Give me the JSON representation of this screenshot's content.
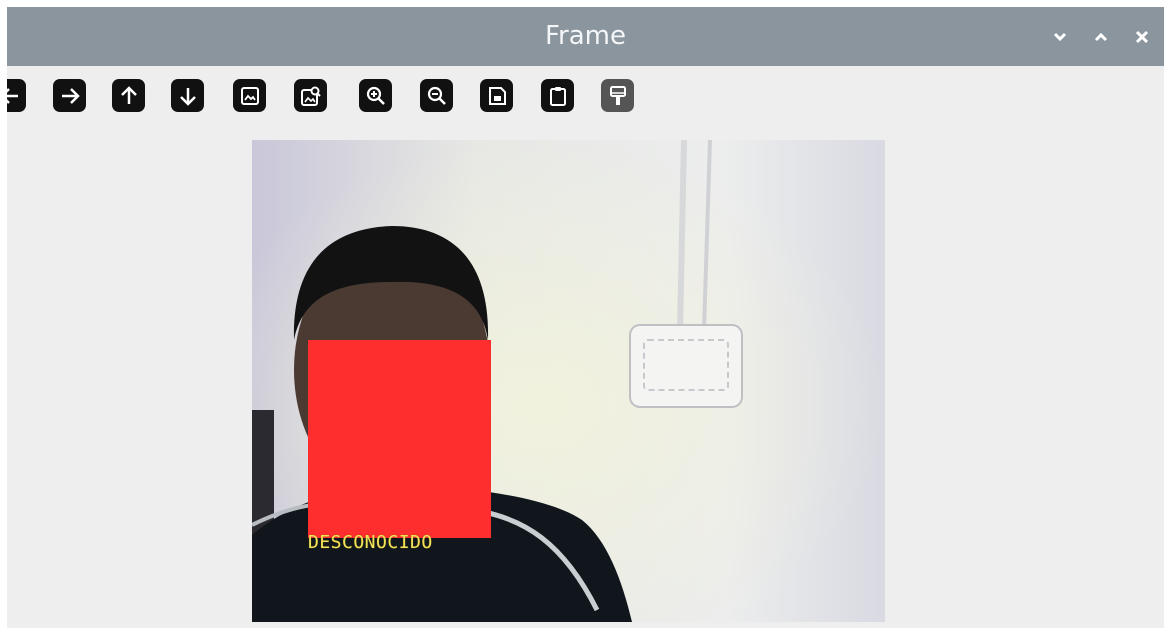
{
  "window": {
    "title": "Frame",
    "controls": [
      {
        "name": "minimize",
        "icon": "chevron-down-icon"
      },
      {
        "name": "maximize",
        "icon": "chevron-up-icon"
      },
      {
        "name": "close",
        "icon": "close-icon"
      }
    ]
  },
  "toolbar": {
    "buttons": [
      {
        "name": "pan-left",
        "icon": "arrow-left-icon"
      },
      {
        "name": "pan-right",
        "icon": "arrow-right-icon"
      },
      {
        "name": "pan-up",
        "icon": "arrow-up-icon"
      },
      {
        "name": "pan-down",
        "icon": "arrow-down-icon"
      },
      {
        "name": "reset-view",
        "icon": "image-icon"
      },
      {
        "name": "zoom-to-fit",
        "icon": "image-search-icon"
      },
      {
        "name": "zoom-in",
        "icon": "zoom-in-icon"
      },
      {
        "name": "zoom-out",
        "icon": "zoom-out-icon"
      },
      {
        "name": "save-image",
        "icon": "save-icon"
      },
      {
        "name": "copy-to-clipboard",
        "icon": "clipboard-icon"
      },
      {
        "name": "properties",
        "icon": "paint-brush-icon"
      }
    ]
  },
  "camera": {
    "face_label": "DESCONOCIDO",
    "face_box_color": "#ff2e2e",
    "label_color": "#f2e25a"
  }
}
